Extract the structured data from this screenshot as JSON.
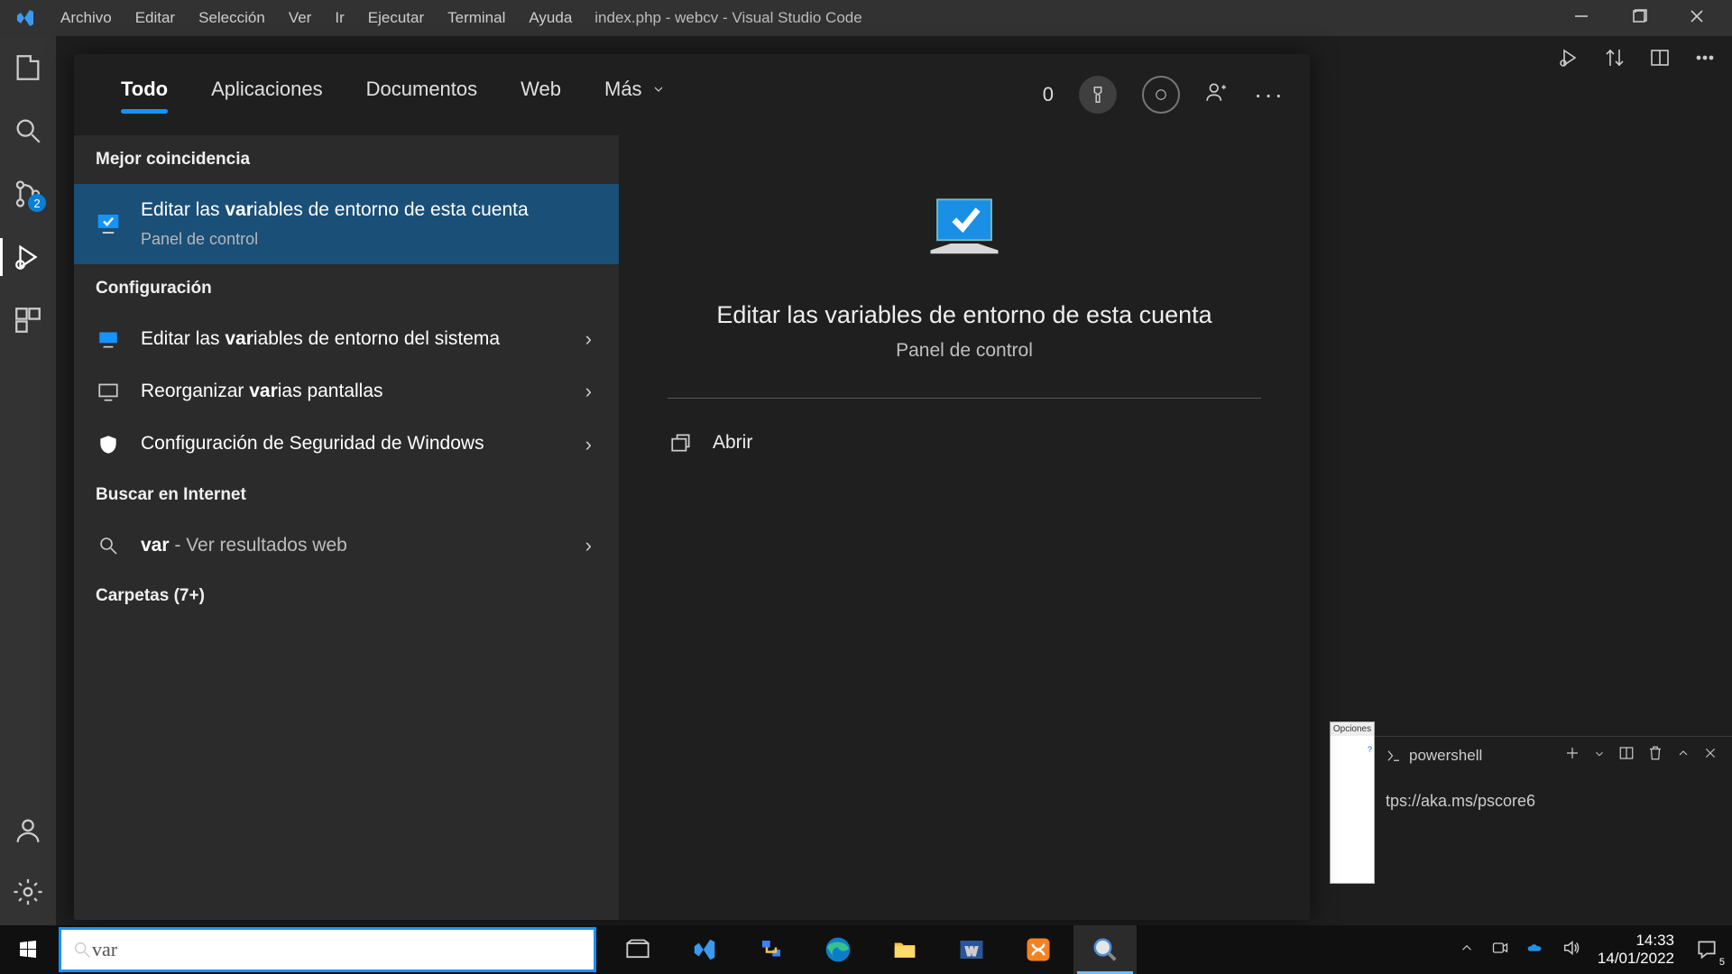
{
  "vscode": {
    "menus": [
      "Archivo",
      "Editar",
      "Selección",
      "Ver",
      "Ir",
      "Ejecutar",
      "Terminal",
      "Ayuda"
    ],
    "title": "index.php - webcv - Visual Studio Code",
    "scm_badge": "2",
    "terminal_name": "powershell",
    "terminal_line": "tps://aka.ms/pscore6"
  },
  "popup": {
    "header": "Opciones"
  },
  "search": {
    "tabs": {
      "all": "Todo",
      "apps": "Aplicaciones",
      "docs": "Documentos",
      "web": "Web",
      "more": "Más"
    },
    "score": "0",
    "sections": {
      "best": "Mejor coincidencia",
      "settings": "Configuración",
      "internet": "Buscar en Internet",
      "folders": "Carpetas (7+)"
    },
    "best_match": {
      "pre": "Editar las ",
      "bold": "var",
      "post": "iables de entorno de esta cuenta",
      "sub": "Panel de control"
    },
    "items": [
      {
        "pre": "Editar las ",
        "bold": "var",
        "post": "iables de entorno del sistema"
      },
      {
        "pre": "Reorganizar ",
        "bold": "var",
        "post": "ias pantallas"
      },
      {
        "plain": "Configuración de Seguridad de Windows"
      }
    ],
    "web_item": {
      "bold": "var",
      "post": " - Ver resultados web"
    },
    "detail": {
      "title": "Editar las variables de entorno de esta cuenta",
      "sub": "Panel de control",
      "open": "Abrir"
    }
  },
  "taskbar": {
    "search_value": "var",
    "time": "14:33",
    "date": "14/01/2022",
    "notif_count": "5"
  }
}
